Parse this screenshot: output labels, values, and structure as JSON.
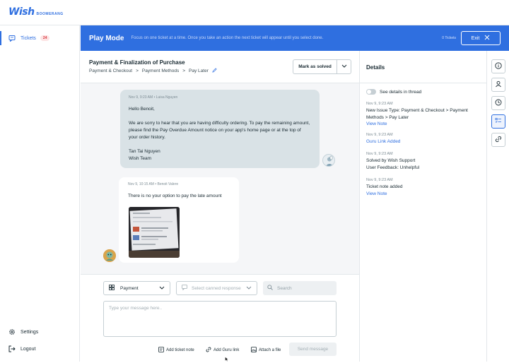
{
  "brand": {
    "name": "Wish",
    "product": "BOOMERANG"
  },
  "sidebar": {
    "items": [
      {
        "label": "Tickets",
        "badge": "24"
      },
      {
        "label": "Settings"
      },
      {
        "label": "Logout"
      }
    ]
  },
  "banner": {
    "title": "Play Mode",
    "description": "Focus on one ticket at a time. Once you take an action the next ticket will appear until you select done.",
    "ticket_count": "0 Tickets",
    "exit_label": "Exit"
  },
  "ticket": {
    "title": "Payment & Finalization of Purchase",
    "breadcrumb": [
      "Payment & Checkout",
      "Payment Methods",
      "Pay Later"
    ],
    "solve_label": "Mark as solved"
  },
  "messages": [
    {
      "meta": "Nov 9, 9:23 AM  •  Luisa Nguyen",
      "greeting": "Hello Benoit,",
      "body": "We are sorry to hear that you are having difficulty ordering. To pay the remaining amount, please find the Pay Overdue Amount notice on your app's home page or at the top of your order history.",
      "signature_name": "Tan Tai Nguyen",
      "signature_team": "Wish Team"
    },
    {
      "meta": "Nov 9, 10:15 AM  •  Benoit Valere",
      "body": "There is no your option to pay the late amount"
    }
  ],
  "composer": {
    "category": "Payment",
    "canned_placeholder": "Select canned response",
    "search_placeholder": "Search",
    "message_placeholder": "Type your message here..",
    "actions": [
      "Add ticket note",
      "Add Guru link",
      "Attach a file"
    ],
    "send_label": "Send message"
  },
  "details": {
    "title": "Details",
    "toggle_label": "See details in thread",
    "events": [
      {
        "date": "Nov 9, 9:23 AM",
        "text_lines": [
          "New Issue Type: Payment & Checkout  >  Payment",
          "Methods  >  Pay Later"
        ],
        "link": "View Note"
      },
      {
        "date": "Nov 9, 9:23 AM",
        "text_lines": [],
        "link": "Guru Link Added"
      },
      {
        "date": "Nov 9, 9:23 AM",
        "text_lines": [
          "Solved by Wish Support",
          "User Feedback: Unhelpful"
        ],
        "link": ""
      },
      {
        "date": "Nov 9, 9:23 AM",
        "text_lines": [
          "Ticket note added"
        ],
        "link": "View Note"
      }
    ]
  },
  "colors": {
    "accent": "#2f6fe0",
    "badge_bg": "#fde4e4",
    "badge_text": "#d7373f",
    "agent_bubble": "#d9e2e6"
  }
}
